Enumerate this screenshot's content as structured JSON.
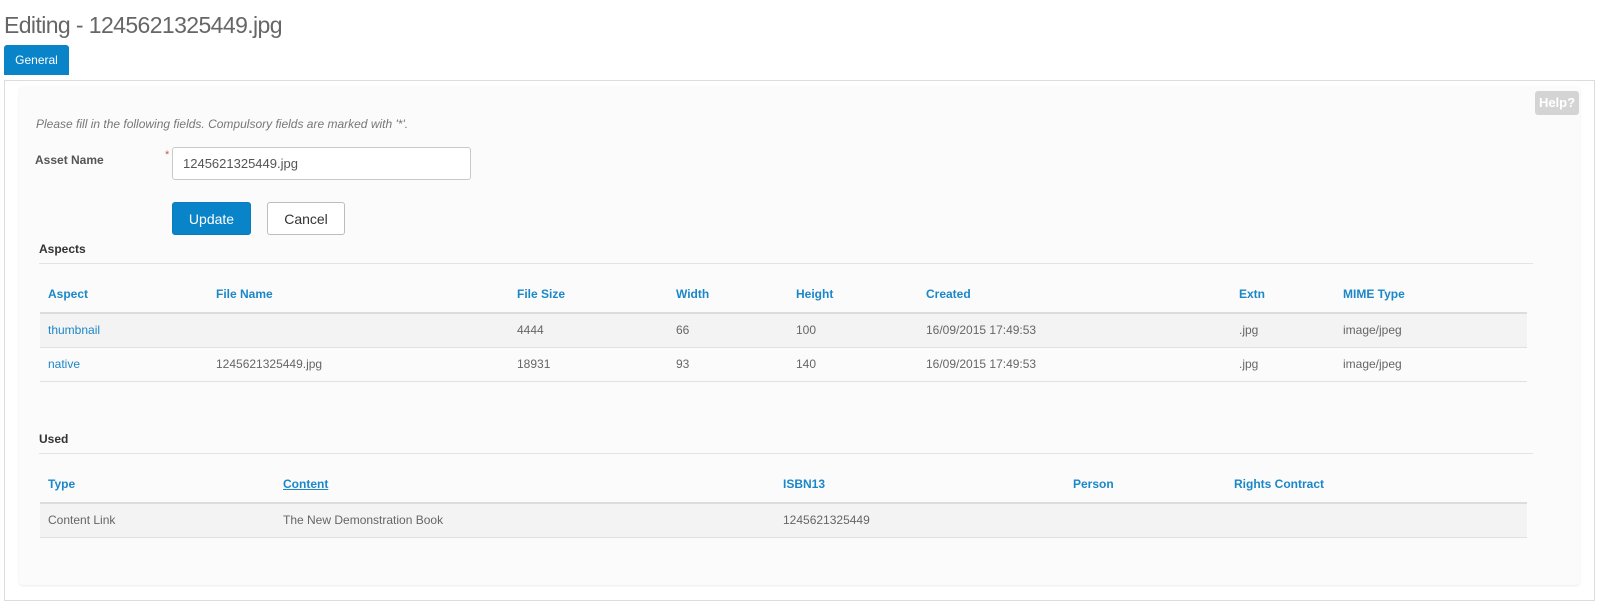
{
  "page": {
    "title": "Editing - 1245621325449.jpg"
  },
  "tabs": [
    {
      "label": "General"
    }
  ],
  "help": {
    "label": "Help?"
  },
  "form": {
    "instructions": "Please fill in the following fields. Compulsory fields are marked with '*'.",
    "asset_name_label": "Asset Name",
    "required_marker": "*",
    "asset_name_value": "1245621325449.jpg",
    "update_label": "Update",
    "cancel_label": "Cancel"
  },
  "aspects": {
    "heading": "Aspects",
    "columns": [
      "Aspect",
      "File Name",
      "File Size",
      "Width",
      "Height",
      "Created",
      "Extn",
      "MIME Type"
    ],
    "rows": [
      [
        "thumbnail",
        "",
        "4444",
        "66",
        "100",
        "16/09/2015 17:49:53",
        ".jpg",
        "image/jpeg"
      ],
      [
        "native",
        "1245621325449.jpg",
        "18931",
        "93",
        "140",
        "16/09/2015 17:49:53",
        ".jpg",
        "image/jpeg"
      ]
    ]
  },
  "used": {
    "heading": "Used",
    "columns": [
      "Type",
      "Content",
      "ISBN13",
      "Person",
      "Rights Contract"
    ],
    "rows": [
      [
        "Content Link",
        "The New Demonstration Book",
        "1245621325449",
        "",
        ""
      ]
    ]
  },
  "colors": {
    "accent": "#0a84c9",
    "link": "#1b87c8",
    "required": "#d9534f"
  }
}
